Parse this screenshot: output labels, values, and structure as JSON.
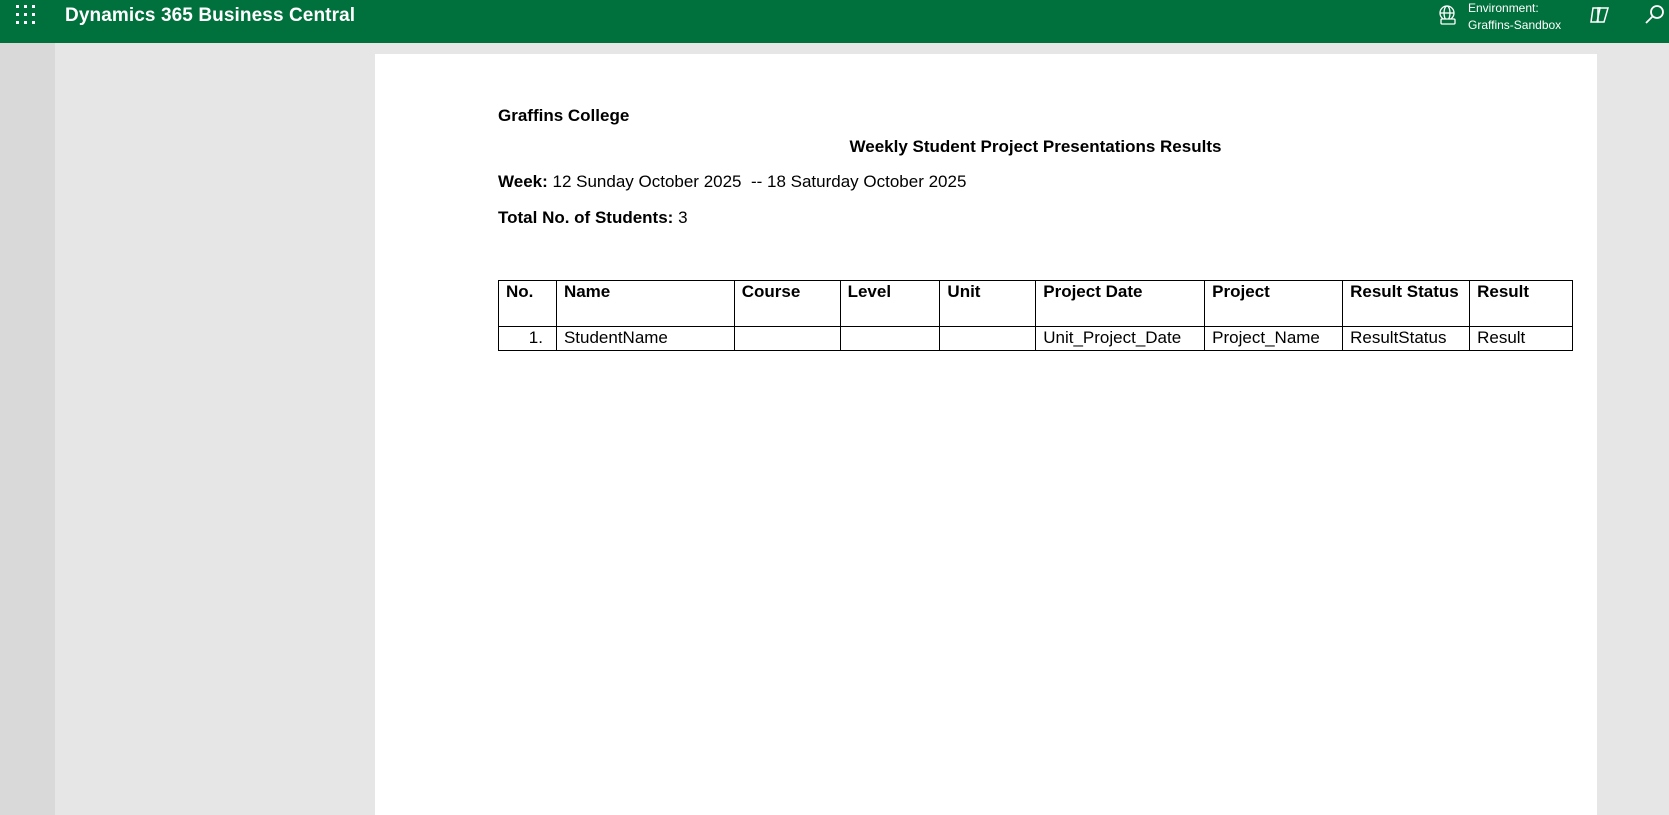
{
  "header": {
    "app_title": "Dynamics 365 Business Central",
    "environment_label": "Environment:",
    "environment_name": "Graffins-Sandbox",
    "brand_color": "#00703c",
    "icons": [
      "app-launcher-icon",
      "environment-globe-icon",
      "copilot-icon",
      "search-icon"
    ]
  },
  "report": {
    "company": "Graffins College",
    "title": "Weekly Student Project Presentations Results",
    "week_label": "Week:",
    "week_value": " 12 Sunday October 2025  -- 18 Saturday October 2025",
    "students_label": "Total No. of Students:",
    "students_value": " 3",
    "table": {
      "columns": [
        "No.",
        "Name",
        "Course",
        "Level",
        "Unit",
        "Project Date",
        "Project",
        "Result Status",
        "Result"
      ],
      "rows": [
        [
          "1.",
          "StudentName",
          "",
          "",
          "",
          "Unit_Project_Date",
          "Project_Name",
          "ResultStatus",
          "Result"
        ]
      ]
    }
  }
}
